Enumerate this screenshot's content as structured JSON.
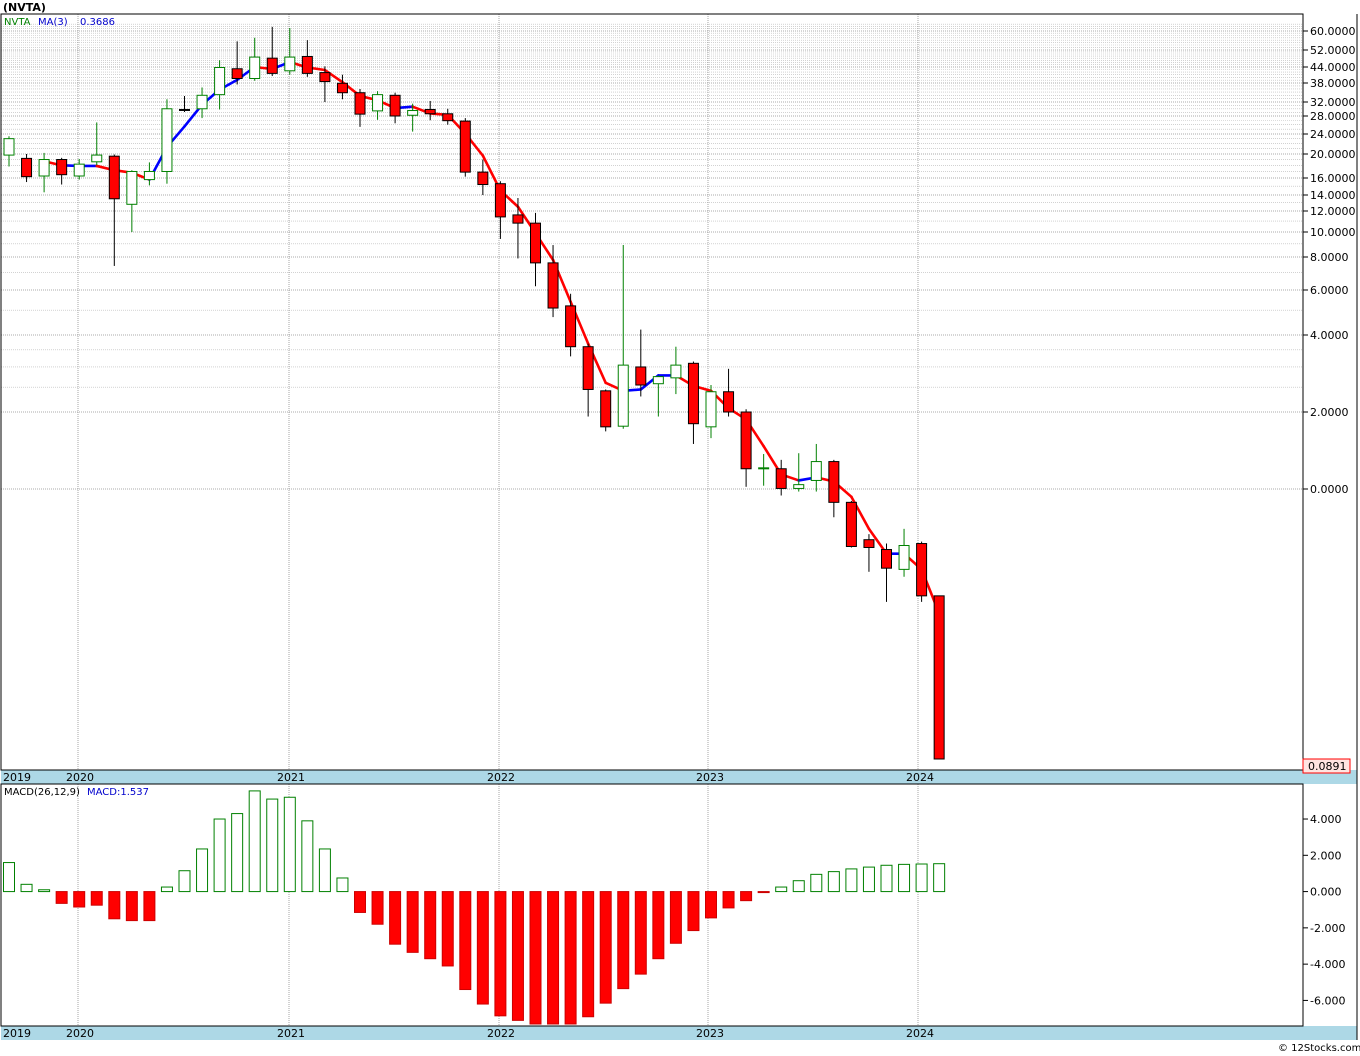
{
  "header": {
    "symbol": "(NVTA)"
  },
  "footer": {
    "copyright": "© 12Stocks.com"
  },
  "colors": {
    "up": "#008000",
    "down": "#ff0000",
    "ma_up": "#0000ff",
    "ma_down": "#ff0000",
    "axis_band": "#add8e6",
    "last_price_box": "#ffe4e1"
  },
  "chart_data": [
    {
      "type": "candlestick",
      "legend": {
        "symbol": "NVTA",
        "ma_label": "MA(3)",
        "ma_value": "0.3686"
      },
      "x_tick_labels": [
        "2019",
        "2020",
        "2021",
        "2022",
        "2023",
        "2024"
      ],
      "y_scale": "log",
      "y_tick_labels": [
        "60.0000",
        "52.0000",
        "44.0000",
        "38.0000",
        "32.0000",
        "28.0000",
        "24.0000",
        "20.0000",
        "16.0000",
        "14.0000",
        "12.0000",
        "10.0000",
        "8.0000",
        "6.0000",
        "4.0000",
        "2.0000",
        "0.0000"
      ],
      "last_price_label": "0.0891",
      "ohlc": [
        {
          "date": "2019-09",
          "o": 19.8,
          "h": 23.5,
          "l": 17.8,
          "c": 23.0
        },
        {
          "date": "2019-10",
          "o": 19.2,
          "h": 20.0,
          "l": 15.5,
          "c": 16.2
        },
        {
          "date": "2019-11",
          "o": 16.3,
          "h": 20.2,
          "l": 14.3,
          "c": 19.0
        },
        {
          "date": "2019-12",
          "o": 19.0,
          "h": 19.3,
          "l": 15.2,
          "c": 16.5
        },
        {
          "date": "2020-01",
          "o": 16.3,
          "h": 19.1,
          "l": 15.8,
          "c": 18.2
        },
        {
          "date": "2020-02",
          "o": 18.6,
          "h": 26.5,
          "l": 18.0,
          "c": 19.8
        },
        {
          "date": "2020-03",
          "o": 19.6,
          "h": 19.9,
          "l": 7.4,
          "c": 13.5
        },
        {
          "date": "2020-04",
          "o": 12.8,
          "h": 17.2,
          "l": 10.0,
          "c": 17.0
        },
        {
          "date": "2020-05",
          "o": 15.8,
          "h": 18.5,
          "l": 15.1,
          "c": 17.0
        },
        {
          "date": "2020-06",
          "o": 17.0,
          "h": 32.8,
          "l": 15.3,
          "c": 30.0
        },
        {
          "date": "2020-07",
          "o": 29.8,
          "h": 33.8,
          "l": 29.1,
          "c": 29.7
        },
        {
          "date": "2020-08",
          "o": 30.0,
          "h": 36.5,
          "l": 27.5,
          "c": 34.0
        },
        {
          "date": "2020-09",
          "o": 34.2,
          "h": 47.0,
          "l": 29.8,
          "c": 43.8
        },
        {
          "date": "2020-10",
          "o": 43.3,
          "h": 55.5,
          "l": 37.5,
          "c": 39.6
        },
        {
          "date": "2020-11",
          "o": 39.6,
          "h": 57.0,
          "l": 38.8,
          "c": 48.5
        },
        {
          "date": "2020-12",
          "o": 48.0,
          "h": 61.8,
          "l": 40.5,
          "c": 41.5
        },
        {
          "date": "2021-01",
          "o": 42.5,
          "h": 61.3,
          "l": 41.0,
          "c": 48.5
        },
        {
          "date": "2021-02",
          "o": 48.8,
          "h": 56.0,
          "l": 40.2,
          "c": 41.5
        },
        {
          "date": "2021-03",
          "o": 41.8,
          "h": 44.3,
          "l": 32.0,
          "c": 38.5
        },
        {
          "date": "2021-04",
          "o": 37.9,
          "h": 41.0,
          "l": 32.8,
          "c": 34.8
        },
        {
          "date": "2021-05",
          "o": 34.8,
          "h": 36.0,
          "l": 25.5,
          "c": 28.5
        },
        {
          "date": "2021-06",
          "o": 29.4,
          "h": 35.3,
          "l": 27.1,
          "c": 34.2
        },
        {
          "date": "2021-07",
          "o": 34.0,
          "h": 34.8,
          "l": 26.3,
          "c": 28.0
        },
        {
          "date": "2021-08",
          "o": 28.2,
          "h": 31.5,
          "l": 24.5,
          "c": 29.5
        },
        {
          "date": "2021-09",
          "o": 29.8,
          "h": 32.3,
          "l": 27.0,
          "c": 28.6
        },
        {
          "date": "2021-10",
          "o": 28.6,
          "h": 30.0,
          "l": 26.0,
          "c": 26.9
        },
        {
          "date": "2021-11",
          "o": 26.8,
          "h": 27.5,
          "l": 16.2,
          "c": 16.9
        },
        {
          "date": "2021-12",
          "o": 16.9,
          "h": 19.0,
          "l": 14.0,
          "c": 15.2
        },
        {
          "date": "2022-01",
          "o": 15.3,
          "h": 15.6,
          "l": 9.4,
          "c": 11.4
        },
        {
          "date": "2022-02",
          "o": 11.6,
          "h": 13.6,
          "l": 7.9,
          "c": 10.8
        },
        {
          "date": "2022-03",
          "o": 10.8,
          "h": 11.8,
          "l": 6.2,
          "c": 7.6
        },
        {
          "date": "2022-04",
          "o": 7.6,
          "h": 8.9,
          "l": 4.7,
          "c": 5.1
        },
        {
          "date": "2022-05",
          "o": 5.2,
          "h": 5.8,
          "l": 3.3,
          "c": 3.6
        },
        {
          "date": "2022-06",
          "o": 3.6,
          "h": 3.7,
          "l": 1.92,
          "c": 2.45
        },
        {
          "date": "2022-07",
          "o": 2.42,
          "h": 2.45,
          "l": 1.68,
          "c": 1.75
        },
        {
          "date": "2022-08",
          "o": 1.76,
          "h": 8.9,
          "l": 1.72,
          "c": 3.05
        },
        {
          "date": "2022-09",
          "o": 3.0,
          "h": 4.2,
          "l": 2.3,
          "c": 2.55
        },
        {
          "date": "2022-10",
          "o": 2.58,
          "h": 2.78,
          "l": 1.92,
          "c": 2.75
        },
        {
          "date": "2022-11",
          "o": 2.72,
          "h": 3.6,
          "l": 2.35,
          "c": 3.05
        },
        {
          "date": "2022-12",
          "o": 3.1,
          "h": 3.15,
          "l": 1.5,
          "c": 1.8
        },
        {
          "date": "2023-01",
          "o": 1.75,
          "h": 2.55,
          "l": 1.58,
          "c": 2.4
        },
        {
          "date": "2023-02",
          "o": 2.4,
          "h": 2.95,
          "l": 1.92,
          "c": 2.0
        },
        {
          "date": "2023-03",
          "o": 2.0,
          "h": 2.05,
          "l": 1.02,
          "c": 1.2
        },
        {
          "date": "2023-04",
          "o": 1.2,
          "h": 1.37,
          "l": 1.03,
          "c": 1.21
        },
        {
          "date": "2023-05",
          "o": 1.2,
          "h": 1.3,
          "l": 0.95,
          "c": 1.005
        },
        {
          "date": "2023-06",
          "o": 1.005,
          "h": 1.38,
          "l": 0.98,
          "c": 1.04
        },
        {
          "date": "2023-07",
          "o": 1.08,
          "h": 1.5,
          "l": 0.98,
          "c": 1.28
        },
        {
          "date": "2023-08",
          "o": 1.28,
          "h": 1.3,
          "l": 0.8,
          "c": 0.9
        },
        {
          "date": "2023-09",
          "o": 0.9,
          "h": 0.91,
          "l": 0.63,
          "c": 0.635
        },
        {
          "date": "2023-10",
          "o": 0.67,
          "h": 0.7,
          "l": 0.52,
          "c": 0.63
        },
        {
          "date": "2023-11",
          "o": 0.62,
          "h": 0.65,
          "l": 0.41,
          "c": 0.535
        },
        {
          "date": "2023-12",
          "o": 0.53,
          "h": 0.73,
          "l": 0.5,
          "c": 0.64
        },
        {
          "date": "2024-01",
          "o": 0.65,
          "h": 0.66,
          "l": 0.41,
          "c": 0.43
        },
        {
          "date": "2024-02",
          "o": 0.43,
          "h": 0.43,
          "l": 0.0891,
          "c": 0.0891
        }
      ],
      "ma3": [
        null,
        null,
        18.7,
        18.0,
        17.9,
        17.9,
        17.2,
        16.8,
        15.8,
        21.3,
        25.6,
        31.2,
        35.8,
        39.1,
        44.0,
        43.2,
        46.2,
        43.8,
        42.8,
        38.3,
        33.8,
        32.5,
        30.2,
        30.6,
        28.7,
        28.3,
        24.1,
        19.7,
        14.5,
        12.5,
        9.9,
        7.8,
        5.4,
        3.7,
        2.6,
        2.42,
        2.45,
        2.78,
        2.78,
        2.53,
        2.42,
        2.07,
        1.87,
        1.47,
        1.14,
        1.08,
        1.11,
        1.07,
        0.94,
        0.73,
        0.6,
        0.6,
        0.53,
        0.3686
      ],
      "ma_colors": [
        "",
        "",
        "up",
        "down",
        "up",
        "up",
        "down",
        "down",
        "down",
        "up",
        "up",
        "up",
        "up",
        "up",
        "up",
        "down",
        "up",
        "down",
        "down",
        "down",
        "down",
        "down",
        "down",
        "up",
        "down",
        "down",
        "down",
        "down",
        "down",
        "down",
        "down",
        "down",
        "down",
        "down",
        "down",
        "down",
        "up",
        "up",
        "up",
        "down",
        "down",
        "down",
        "down",
        "down",
        "down",
        "down",
        "up",
        "down",
        "down",
        "down",
        "down",
        "up",
        "down",
        "down"
      ]
    },
    {
      "type": "bar",
      "title": "MACD(26,12,9)",
      "legend_value_label": "MACD:1.537",
      "x_tick_labels": [
        "2019",
        "2020",
        "2021",
        "2022",
        "2023",
        "2024"
      ],
      "y_tick_labels": [
        "4.000",
        "2.000",
        "0.000",
        "-2.000",
        "-4.000",
        "-6.000"
      ],
      "ylim": [
        -7.3,
        5.6
      ],
      "values": [
        1.6,
        0.4,
        0.1,
        -0.65,
        -0.85,
        -0.75,
        -1.5,
        -1.6,
        -1.6,
        0.25,
        1.15,
        2.35,
        4.0,
        4.3,
        5.55,
        5.1,
        5.2,
        3.9,
        2.35,
        0.75,
        -1.15,
        -1.8,
        -2.9,
        -3.35,
        -3.7,
        -4.1,
        -5.4,
        -6.2,
        -6.85,
        -7.1,
        -7.3,
        -7.3,
        -7.3,
        -6.9,
        -6.15,
        -5.35,
        -4.55,
        -3.7,
        -2.85,
        -2.15,
        -1.45,
        -0.9,
        -0.5,
        -0.05,
        0.25,
        0.6,
        0.95,
        1.1,
        1.25,
        1.35,
        1.45,
        1.5,
        1.52,
        1.537
      ]
    }
  ]
}
